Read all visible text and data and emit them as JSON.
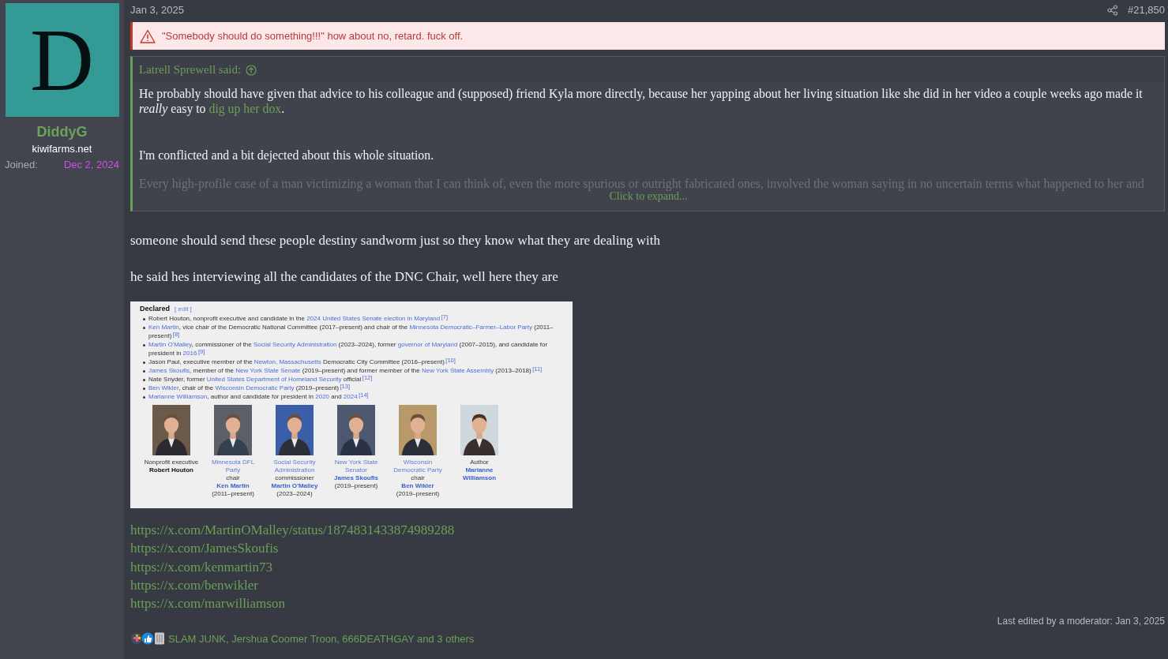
{
  "author": {
    "avatar_letter": "D",
    "name": "DiddyG",
    "title": "kiwifarms.net",
    "joined_label": "Joined:",
    "joined_date": "Dec 2, 2024"
  },
  "post": {
    "date": "Jan 3, 2025",
    "number": "#21,850",
    "notice": "\"Somebody should do something!!!\" how about no, retard. fuck off.",
    "quote": {
      "attribution": "Latrell Sprewell said:",
      "paragraphs": [
        "He probably should have given that advice to his colleague and (supposed) friend Kyla more directly, because her yapping about her living situation like she did in her video a couple weeks ago made it",
        "*really* easy to",
        "I'm conflicted and a bit dejected about this whole situation."
      ],
      "link": "dig up her dox",
      "link_tail": ".",
      "faded": "Every high-profile case of a man victimizing a woman that I can think of, even the more spurious or outright fabricated ones, involved the woman saying in no uncertain terms what happened to her and",
      "expand": "Click to expand..."
    },
    "paragraphs": [
      "someone should send these people destiny sandworm just so they know what they are dealing with",
      "he said hes interviewing all the candidates of the DNC Chair, well here they are"
    ],
    "embed": {
      "heading": "Declared",
      "edit": "[ edit ]",
      "items": [
        [
          {
            "kind": "text",
            "text": "Robert Houton, nonprofit executive and candidate in the "
          },
          {
            "kind": "link",
            "text": "2024 United States Senate election in Maryland"
          },
          {
            "kind": "ref",
            "text": "[7]"
          }
        ],
        [
          {
            "kind": "link",
            "text": "Ken Martin"
          },
          {
            "kind": "text",
            "text": ", vice chair of the Democratic National Committee (2017–present) and chair of the "
          },
          {
            "kind": "link",
            "text": "Minnesota Democratic–Farmer–Labor Party"
          },
          {
            "kind": "text",
            "text": " (2011–present)"
          },
          {
            "kind": "ref",
            "text": "[8]"
          }
        ],
        [
          {
            "kind": "link",
            "text": "Martin O'Malley"
          },
          {
            "kind": "text",
            "text": ", commissioner of the "
          },
          {
            "kind": "link",
            "text": "Social Security Administration"
          },
          {
            "kind": "text",
            "text": " (2023–2024), former "
          },
          {
            "kind": "link",
            "text": "governor of Maryland"
          },
          {
            "kind": "text",
            "text": " (2007–2015), and candidate for president in "
          },
          {
            "kind": "link",
            "text": "2016"
          },
          {
            "kind": "ref",
            "text": "[9]"
          }
        ],
        [
          {
            "kind": "text",
            "text": "Jason Paul, executive member of the "
          },
          {
            "kind": "link",
            "text": "Newton, Massachusetts"
          },
          {
            "kind": "text",
            "text": " Democratic City Committee (2016–present)"
          },
          {
            "kind": "ref",
            "text": "[10]"
          }
        ],
        [
          {
            "kind": "link",
            "text": "James Skoufis"
          },
          {
            "kind": "text",
            "text": ", member of the "
          },
          {
            "kind": "link",
            "text": "New York State Senate"
          },
          {
            "kind": "text",
            "text": " (2019–present) and former member of the "
          },
          {
            "kind": "link",
            "text": "New York State Assembly"
          },
          {
            "kind": "text",
            "text": " (2013–2018)"
          },
          {
            "kind": "ref",
            "text": "[11]"
          }
        ],
        [
          {
            "kind": "text",
            "text": "Nate Snyder, former "
          },
          {
            "kind": "link",
            "text": "United States Department of Homeland Security"
          },
          {
            "kind": "text",
            "text": " official"
          },
          {
            "kind": "ref",
            "text": "[12]"
          }
        ],
        [
          {
            "kind": "link",
            "text": "Ben Wikler"
          },
          {
            "kind": "text",
            "text": ", chair of the "
          },
          {
            "kind": "link",
            "text": "Wisconsin Democratic Party"
          },
          {
            "kind": "text",
            "text": " (2019–present)"
          },
          {
            "kind": "ref",
            "text": "[13]"
          }
        ],
        [
          {
            "kind": "link",
            "text": "Marianne Williamson"
          },
          {
            "kind": "text",
            "text": ", author and candidate for president in "
          },
          {
            "kind": "link",
            "text": "2020"
          },
          {
            "kind": "text",
            "text": " and "
          },
          {
            "kind": "link",
            "text": "2024"
          },
          {
            "kind": "ref",
            "text": "[14]"
          }
        ]
      ],
      "candidates": [
        {
          "photo": {
            "kind": "picture"
          },
          "caption": [
            {
              "kind": "text",
              "text": "Nonprofit executive"
            },
            {
              "kind": "name",
              "text": "Robert Houton"
            }
          ]
        },
        {
          "photo": {
            "kind": "picture"
          },
          "caption": [
            {
              "kind": "link",
              "text": "Minnesota DFL Party"
            },
            {
              "kind": "text",
              "text": " chair"
            },
            {
              "kind": "name_link",
              "text": "Ken Martin"
            },
            {
              "kind": "date",
              "text": "(2011–present)"
            }
          ]
        },
        {
          "photo": {
            "kind": "picture"
          },
          "caption": [
            {
              "kind": "link",
              "text": "Social Security Administration"
            },
            {
              "kind": "text",
              "text": " commissioner"
            },
            {
              "kind": "name_link",
              "text": "Martin O'Malley"
            },
            {
              "kind": "date",
              "text": "(2023–2024)"
            }
          ]
        },
        {
          "photo": {
            "kind": "picture"
          },
          "caption": [
            {
              "kind": "link",
              "text": "New York State Senator"
            },
            {
              "kind": "name_link",
              "text": "James Skoufis"
            },
            {
              "kind": "date",
              "text": "(2019–present)"
            }
          ]
        },
        {
          "photo": {
            "kind": "picture"
          },
          "caption": [
            {
              "kind": "link",
              "text": "Wisconsin Democratic Party"
            },
            {
              "kind": "text",
              "text": " chair"
            },
            {
              "kind": "name_link",
              "text": "Ben Wikler"
            },
            {
              "kind": "date",
              "text": "(2019–present)"
            }
          ]
        },
        {
          "photo": {
            "kind": "picture"
          },
          "caption": [
            {
              "kind": "text",
              "text": "Author"
            },
            {
              "kind": "name_link",
              "text": "Marianne Williamson"
            }
          ]
        }
      ]
    },
    "links": [
      "https://x.com/MartinOMalley/status/1874831433874989288",
      "https://x.com/JamesSkoufis",
      "https://x.com/kenmartin73",
      "https://x.com/benwikler",
      "https://x.com/marwilliamson"
    ],
    "edited": "Last edited by a moderator: Jan 3, 2025",
    "reactions": "SLAM JUNK, Jershua Coomer Troon, 666DEATHGAY and 3 others"
  }
}
